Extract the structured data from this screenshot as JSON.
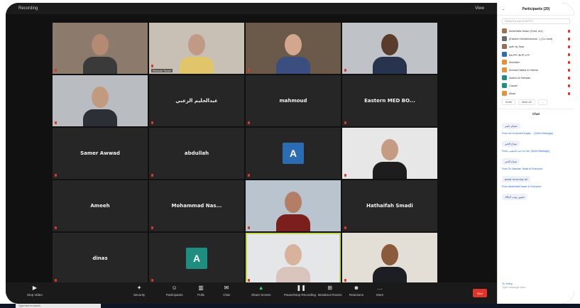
{
  "topbar": {
    "app": "Recording",
    "view": "View"
  },
  "tiles": [
    {
      "name": "",
      "tag": "",
      "kind": "video",
      "bg": "#8c7b6c",
      "skin": "#b48a74",
      "shirt": "#3a3a3a"
    },
    {
      "name": "",
      "tag": "Marwan Tarazi",
      "kind": "video",
      "bg": "#c9c0b5",
      "skin": "#c09a84",
      "shirt": "#e1c56a"
    },
    {
      "name": "",
      "tag": "",
      "kind": "video",
      "bg": "#6b5a4a",
      "skin": "#d3a68e",
      "shirt": "#3b4e80"
    },
    {
      "name": "",
      "tag": "",
      "kind": "video",
      "bg": "#bfc2c6",
      "skin": "#5a3c2c",
      "shirt": "#28344d"
    },
    {
      "name": "",
      "tag": "",
      "kind": "video",
      "bg": "#b9bcc0",
      "skin": "#c29a80",
      "shirt": "#2d2f36"
    },
    {
      "name": "عبدالحليم الزعبي",
      "tag": "",
      "kind": "name"
    },
    {
      "name": "mahmoud",
      "tag": "",
      "kind": "name"
    },
    {
      "name": "Eastern MED BO...",
      "tag": "",
      "kind": "name"
    },
    {
      "name": "Samer Awwad",
      "tag": "",
      "kind": "name"
    },
    {
      "name": "abdullah",
      "tag": "",
      "kind": "name"
    },
    {
      "name": "",
      "tag": "",
      "kind": "letter",
      "letter": "A",
      "color": "#2b6cb3"
    },
    {
      "name": "",
      "tag": "",
      "kind": "video",
      "bg": "#e7e7e7",
      "skin": "#c49c83",
      "shirt": "#1d1d1d"
    },
    {
      "name": "Ameeh",
      "tag": "",
      "kind": "name"
    },
    {
      "name": "Mohammad Nas...",
      "tag": "",
      "kind": "name"
    },
    {
      "name": "",
      "tag": "",
      "kind": "video",
      "bg": "#b9c4cf",
      "skin": "#b47e66",
      "shirt": "#7a1f1c"
    },
    {
      "name": "Hathaifah Smadi",
      "tag": "",
      "kind": "name"
    },
    {
      "name": "dinas",
      "tag": "",
      "kind": "name"
    },
    {
      "name": "",
      "tag": "",
      "kind": "letter",
      "letter": "A",
      "color": "#1f8e80"
    },
    {
      "name": "",
      "tag": "",
      "kind": "video",
      "bg": "#e5e6e8",
      "skin": "#d8b29c",
      "shirt": "#d8c4bc",
      "active": true
    },
    {
      "name": "",
      "tag": "",
      "kind": "video",
      "bg": "#e3dfd6",
      "skin": "#8b5a3c",
      "shirt": "#1c1e24"
    }
  ],
  "toolbar": {
    "items": [
      {
        "label": "Stop Video",
        "icon": "▶"
      },
      {
        "label": "Security",
        "icon": "✦"
      },
      {
        "label": "Participants",
        "icon": "☺"
      },
      {
        "label": "Polls",
        "icon": "▥"
      },
      {
        "label": "Chat",
        "icon": "✉"
      },
      {
        "label": "Share Screen",
        "icon": "▲"
      },
      {
        "label": "Pause/Stop Recording",
        "icon": "❚❚"
      },
      {
        "label": "Breakout Rooms",
        "icon": "⊞"
      },
      {
        "label": "Reactions",
        "icon": "☻"
      },
      {
        "label": "More",
        "icon": "…"
      }
    ],
    "end": "End"
  },
  "panel": {
    "title": "Participants (20)",
    "search": "Search a user (Ctrl+F)",
    "participants": [
      {
        "name": "Abdelhafiz Naser (Host, me)",
        "color": "#a0724e"
      },
      {
        "name": "(Eastern Mediterranean...) (Co-host)",
        "color": "#6a6a6a"
      },
      {
        "name": "auth by Saar",
        "color": "#9a6b55"
      },
      {
        "name": "مدير فريق مشروع",
        "color": "#2b6cb3"
      },
      {
        "name": "Abdullah",
        "color": "#e8903a"
      },
      {
        "name": "Ahmad Habba ei Hamwi",
        "color": "#e8903a"
      },
      {
        "name": "Awlera Al Sahwan",
        "color": "#1f8e80"
      },
      {
        "name": "Casani",
        "color": "#1f8e80"
      },
      {
        "name": "dinas",
        "color": "#e8903a"
      }
    ],
    "buttons": [
      "Invite",
      "Mute All",
      "..."
    ],
    "chat_title": "Chat",
    "messages": [
      {
        "meta": "",
        "text": "عصام ناصر"
      },
      {
        "meta": "From me to Ahmed Amjad ... (Direct Message)",
        "text": "صباح الخير"
      },
      {
        "meta": "From احمد الخطيب to me: (Direct Message)",
        "text": "صباح الخير"
      },
      {
        "meta": "From Dr. Marwan Tarazi to Everyone:",
        "text": "good morning all"
      },
      {
        "meta": "From Abdelhafiz Naser to Everyone:",
        "text": "حضور نوتب البلاك"
      }
    ],
    "to": "To: Every...",
    "input": "Type message here ..."
  },
  "taskbar": {
    "search": "Type here to search"
  }
}
